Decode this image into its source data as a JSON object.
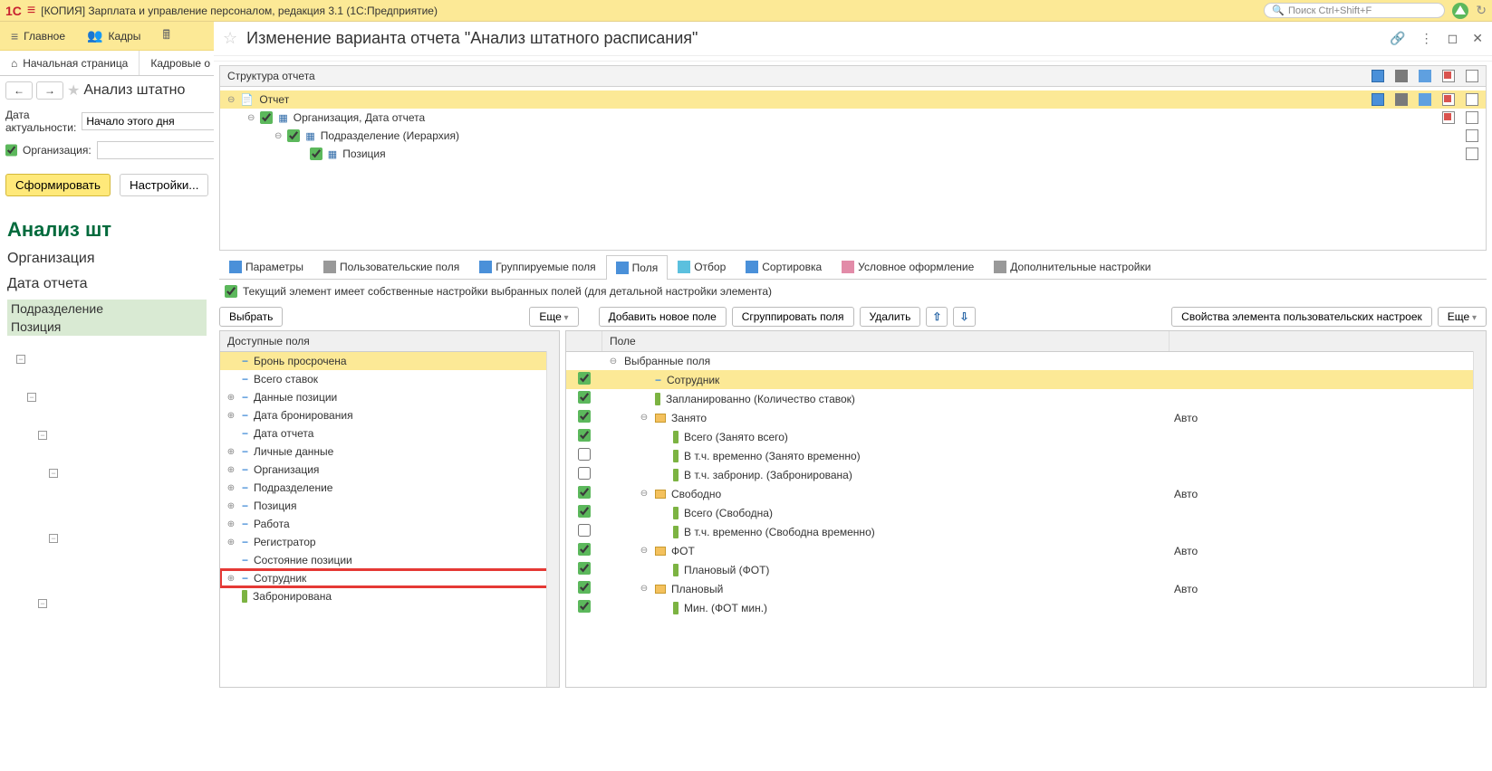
{
  "topbar": {
    "app_title": "[КОПИЯ] Зарплата и управление персоналом, редакция 3.1  (1С:Предприятие)",
    "search_placeholder": "Поиск Ctrl+Shift+F"
  },
  "menu": {
    "main": "Главное",
    "kadry": "Кадры"
  },
  "tabs": {
    "start": "Начальная страница",
    "kadrovye": "Кадровые о"
  },
  "left": {
    "title": "Анализ штатно",
    "date_label": "Дата актуальности:",
    "date_value": "Начало этого дня",
    "org_label": "Организация:",
    "btn_form": "Сформировать",
    "btn_settings": "Настройки...",
    "report_title": "Анализ шт",
    "report_org": "Организация",
    "report_date": "Дата отчета",
    "group1": "Подразделение",
    "group2": "Позиция"
  },
  "dialog": {
    "title": "Изменение варианта отчета \"Анализ штатного расписания\""
  },
  "structure": {
    "header": "Структура отчета",
    "row0": "Отчет",
    "row1": "Организация, Дата отчета",
    "row2": "Подразделение (Иерархия)",
    "row3": "Позиция"
  },
  "ltabs": {
    "params": "Параметры",
    "user_fields": "Пользовательские поля",
    "group_fields": "Группируемые поля",
    "fields": "Поля",
    "filter": "Отбор",
    "sort": "Сортировка",
    "cond_format": "Условное оформление",
    "extra": "Дополнительные настройки"
  },
  "cb_line": "Текущий элемент имеет собственные настройки выбранных полей (для детальной настройки элемента)",
  "toolbar": {
    "select": "Выбрать",
    "more1": "Еще",
    "add": "Добавить новое поле",
    "group": "Сгруппировать поля",
    "delete": "Удалить",
    "props": "Свойства элемента пользовательских настроек",
    "more2": "Еще"
  },
  "avail": {
    "header": "Доступные поля",
    "items": [
      {
        "exp": "",
        "icon": "dash",
        "label": "Бронь просрочена",
        "hl": true
      },
      {
        "exp": "",
        "icon": "dash",
        "label": "Всего ставок"
      },
      {
        "exp": "⊕",
        "icon": "dash",
        "label": "Данные позиции"
      },
      {
        "exp": "⊕",
        "icon": "dash",
        "label": "Дата бронирования"
      },
      {
        "exp": "",
        "icon": "dash",
        "label": "Дата отчета"
      },
      {
        "exp": "⊕",
        "icon": "dash",
        "label": "Личные данные"
      },
      {
        "exp": "⊕",
        "icon": "dash",
        "label": "Организация"
      },
      {
        "exp": "⊕",
        "icon": "dash",
        "label": "Подразделение"
      },
      {
        "exp": "⊕",
        "icon": "dash",
        "label": "Позиция"
      },
      {
        "exp": "⊕",
        "icon": "dash",
        "label": "Работа"
      },
      {
        "exp": "⊕",
        "icon": "dash",
        "label": "Регистратор"
      },
      {
        "exp": "",
        "icon": "dash",
        "label": "Состояние позиции"
      },
      {
        "exp": "⊕",
        "icon": "dash",
        "label": "Сотрудник",
        "boxed": true
      },
      {
        "exp": "",
        "icon": "green",
        "label": "Забронирована"
      }
    ]
  },
  "selected": {
    "header": "Поле",
    "root": "Выбранные поля",
    "items": [
      {
        "cb": true,
        "indent": 1,
        "icon": "dash",
        "label": "Сотрудник",
        "hl": true
      },
      {
        "cb": true,
        "indent": 1,
        "icon": "green",
        "label": "Запланированно (Количество ставок)"
      },
      {
        "cb": true,
        "indent": 1,
        "icon": "folder",
        "exp": "⊖",
        "label": "Занято",
        "val": "Авто"
      },
      {
        "cb": true,
        "indent": 2,
        "icon": "green",
        "label": "Всего (Занято всего)"
      },
      {
        "cb": false,
        "indent": 2,
        "icon": "green",
        "label": "В т.ч. временно (Занято временно)"
      },
      {
        "cb": false,
        "indent": 2,
        "icon": "green",
        "label": "В т.ч. забронир. (Забронирована)"
      },
      {
        "cb": true,
        "indent": 1,
        "icon": "folder",
        "exp": "⊖",
        "label": "Свободно",
        "val": "Авто"
      },
      {
        "cb": true,
        "indent": 2,
        "icon": "green",
        "label": "Всего (Свободна)"
      },
      {
        "cb": false,
        "indent": 2,
        "icon": "green",
        "label": "В т.ч. временно (Свободна временно)"
      },
      {
        "cb": true,
        "indent": 1,
        "icon": "folder",
        "exp": "⊖",
        "label": "ФОТ",
        "val": "Авто"
      },
      {
        "cb": true,
        "indent": 2,
        "icon": "green",
        "label": "Плановый (ФОТ)"
      },
      {
        "cb": true,
        "indent": 1,
        "icon": "folder",
        "exp": "⊖",
        "label": "Плановый",
        "val": "Авто"
      },
      {
        "cb": true,
        "indent": 2,
        "icon": "green",
        "label": "Мин. (ФОТ мин.)"
      }
    ]
  }
}
